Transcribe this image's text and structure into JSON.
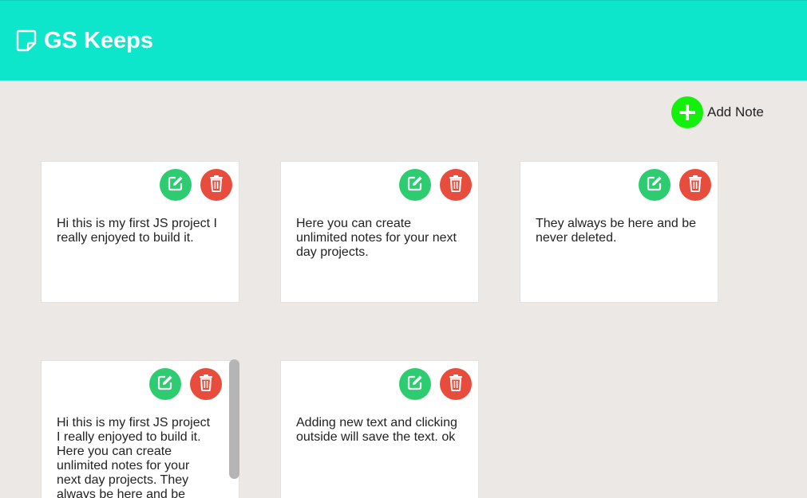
{
  "app": {
    "title": "GS Keeps",
    "add_note_label": "Add Note"
  },
  "notes": [
    {
      "text": "Hi this is my first JS project I\nreally enjoyed to build it."
    },
    {
      "text": "Here you can create\nunlimited notes for your next\nday projects."
    },
    {
      "text": "They always be here and be\nnever deleted."
    },
    {
      "text": "Hi this is my first JS project\nI really enjoyed to build it.\nHere you can create\nunlimited notes for your\nnext day projects. They\nalways be here and be"
    },
    {
      "text": "Adding new text and clicking\noutside will save the text. ok"
    }
  ],
  "icons": {
    "logo": "sticky-note-icon",
    "add": "plus-icon",
    "edit": "edit-icon",
    "delete": "trash-icon"
  },
  "colors": {
    "header": "#0ee6cc",
    "background": "#ebe8e6",
    "add_button": "#12f00c",
    "edit_button": "#2ecc71",
    "delete_button": "#e74c3c"
  }
}
